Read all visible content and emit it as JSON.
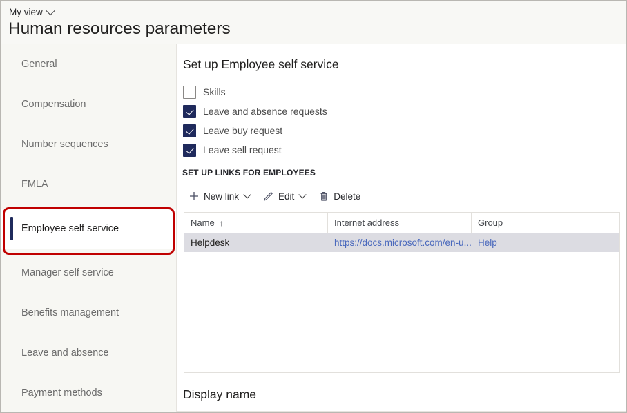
{
  "header": {
    "view_selector": "My view",
    "title": "Human resources parameters"
  },
  "sidebar": {
    "items": [
      {
        "label": "General",
        "selected": false
      },
      {
        "label": "Compensation",
        "selected": false
      },
      {
        "label": "Number sequences",
        "selected": false
      },
      {
        "label": "FMLA",
        "selected": false
      },
      {
        "label": "Employee self service",
        "selected": true
      },
      {
        "label": "Manager self service",
        "selected": false
      },
      {
        "label": "Benefits management",
        "selected": false
      },
      {
        "label": "Leave and absence",
        "selected": false
      },
      {
        "label": "Payment methods",
        "selected": false
      }
    ]
  },
  "annotation": {
    "color": "#c00000",
    "target": "Employee self service"
  },
  "main": {
    "section_title": "Set up Employee self service",
    "checkboxes": [
      {
        "label": "Skills",
        "checked": false
      },
      {
        "label": "Leave and absence requests",
        "checked": true
      },
      {
        "label": "Leave buy request",
        "checked": true
      },
      {
        "label": "Leave sell request",
        "checked": true
      }
    ],
    "group_caption": "SET UP LINKS FOR EMPLOYEES",
    "toolbar": [
      {
        "label": "New link",
        "icon": "plus-icon",
        "glyph": "+",
        "caret": true
      },
      {
        "label": "Edit",
        "icon": "pencil-icon",
        "glyph": "",
        "caret": true
      },
      {
        "label": "Delete",
        "icon": "trash-icon",
        "glyph": "",
        "caret": false
      }
    ],
    "grid": {
      "columns": [
        {
          "label": "Name",
          "sort": "↑"
        },
        {
          "label": "Internet address",
          "sort": ""
        },
        {
          "label": "Group",
          "sort": ""
        }
      ],
      "rows": [
        {
          "name": "Helpdesk",
          "internet_address": "https://docs.microsoft.com/en-u...",
          "group": "Help",
          "selected": true
        }
      ]
    },
    "footer_label": "Display name"
  },
  "colors": {
    "accent_navy": "#1f2a5c",
    "annotation_red": "#c00000",
    "row_selected": "#dcdce2",
    "link_blue": "#4a69bd",
    "sidebar_bg": "#f7f7f3"
  }
}
